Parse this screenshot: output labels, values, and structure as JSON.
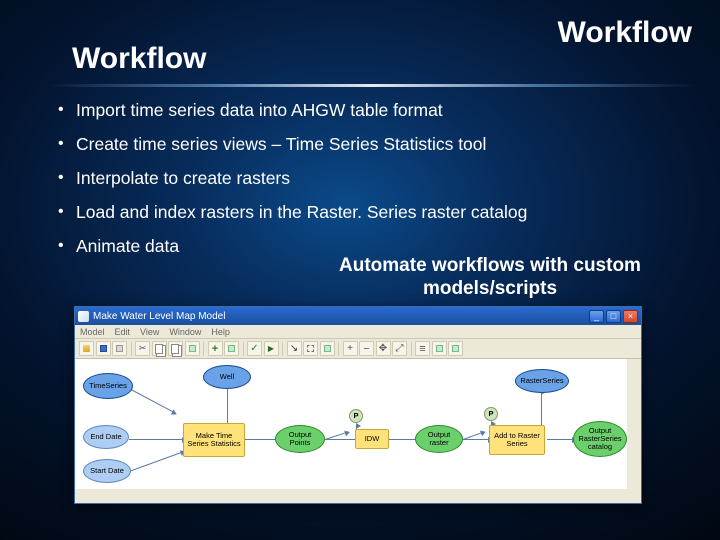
{
  "slide": {
    "title_right": "Workflow",
    "title_left": "Workflow",
    "bullets": [
      "Import time series data into AHGW table format",
      "Create time series views – Time Series Statistics tool",
      "Interpolate to create rasters",
      "Load and index rasters in the Raster. Series raster catalog",
      "Animate data"
    ],
    "automate_line1": "Automate workflows with custom",
    "automate_line2": "models/scripts"
  },
  "model_window": {
    "title": "Make Water Level Map Model",
    "menubar": [
      "Model",
      "Edit",
      "View",
      "Window",
      "Help"
    ],
    "win_buttons": {
      "minimize": "_",
      "maximize": "□",
      "close": "×"
    },
    "nodes": {
      "time_series": "TimeSeries",
      "well": "Well",
      "end_date": "End Date",
      "start_date": "Start Date",
      "make_ts_stats": "Make Time Series Statistics",
      "output_points": "Output Points",
      "p1": "P",
      "idw": "IDW",
      "output_raster": "Output raster",
      "p2": "P",
      "add_to_rs": "Add to Raster Series",
      "raster_series": "RasterSeries",
      "out_rs_catalog": "Output RasterSeries catalog"
    }
  }
}
